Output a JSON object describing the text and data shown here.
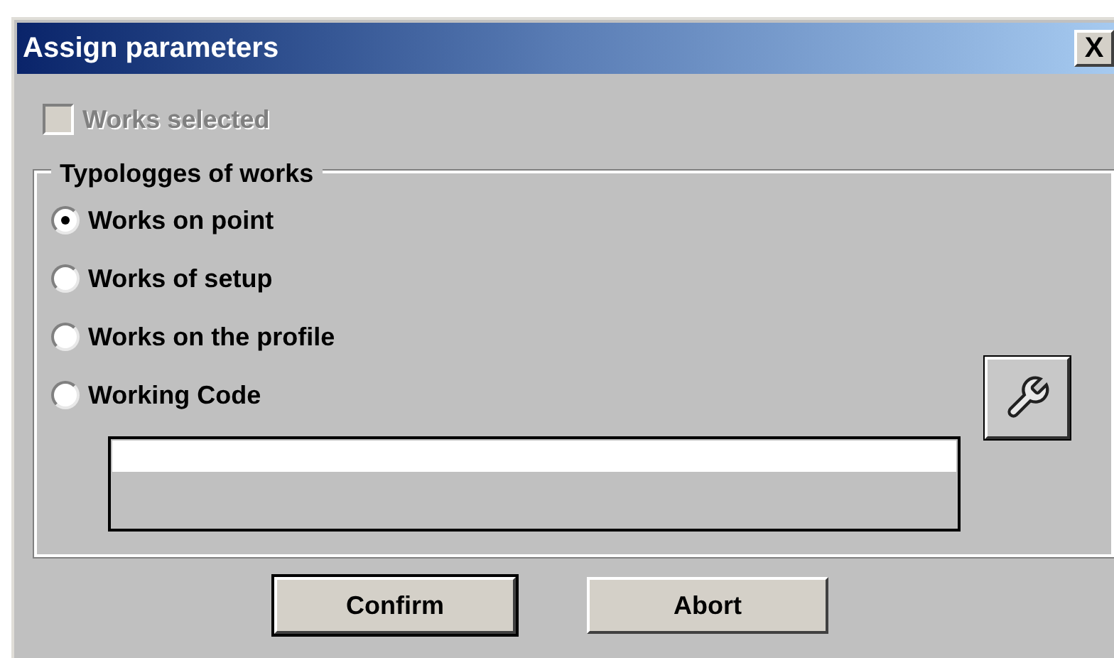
{
  "window": {
    "title": "Assign parameters",
    "close": "X"
  },
  "works_selected": {
    "label": "Works selected",
    "checked": false,
    "disabled": true
  },
  "typologies": {
    "title": "Typologges of works",
    "options": [
      {
        "label": "Works on point",
        "selected": true
      },
      {
        "label": "Works of setup",
        "selected": false
      },
      {
        "label": "Works on the profile",
        "selected": false
      },
      {
        "label": "Working Code",
        "selected": false
      }
    ]
  },
  "buttons": [
    "Confirm",
    "Abort"
  ]
}
